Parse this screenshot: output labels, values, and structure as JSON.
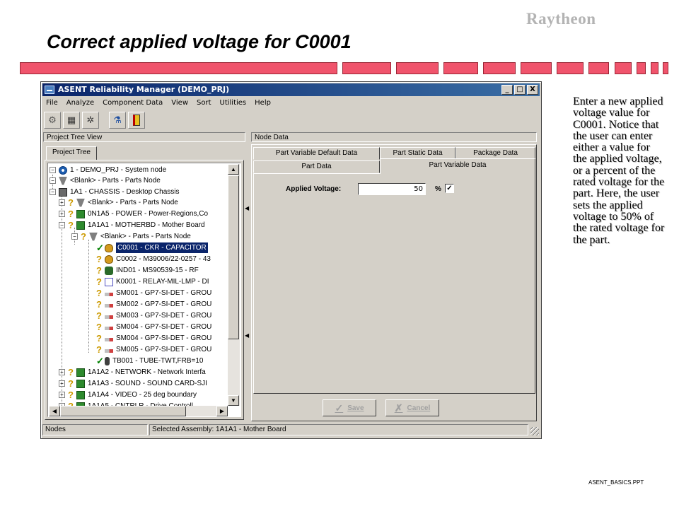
{
  "slide": {
    "logo_text": "Raytheon",
    "title": "Correct applied voltage for C0001",
    "description": "Enter a new applied voltage value for C0001. Notice that the user can enter either a value for the applied voltage, or a percent of the rated voltage for the part. Here, the user sets the applied voltage to 50% of the rated voltage for the part.",
    "footer": "ASENT_BASICS.PPT",
    "stripe_color": "#f0546c"
  },
  "window": {
    "title": "ASENT Reliability Manager (DEMO_PRJ)",
    "caption_buttons": [
      "_",
      "□",
      "X"
    ],
    "menu": [
      "File",
      "Analyze",
      "Component Data",
      "View",
      "Sort",
      "Utilities",
      "Help"
    ],
    "toolbar_icons": [
      "parts-library-icon",
      "calculator-icon",
      "settings-gear-icon",
      "analysis-icon",
      "exit-door-icon"
    ],
    "title_color": "#0a246a"
  },
  "project_tree": {
    "pane_label": "Project Tree View",
    "tab_label": "Project Tree",
    "rows": [
      {
        "text": "1  -  DEMO_PRJ  -  System node",
        "icon": "system-node-icon"
      },
      {
        "text": "<Blank>  -  Parts  -  Parts Node",
        "icon": "parts-node-icon"
      },
      {
        "text": "1A1  -  CHASSIS  -  Desktop Chassis",
        "icon": "chassis-icon"
      },
      {
        "text": "<Blank>  -  Parts  -  Parts Node",
        "icon": "parts-node-icon"
      },
      {
        "text": "0N1A5  -  POWER  -  Power-Regions,Co",
        "icon": "board-icon"
      },
      {
        "text": "1A1A1  -  MOTHERBD  -  Mother Board",
        "icon": "board-icon"
      },
      {
        "text": "<Blank>  -  Parts  -  Parts Node",
        "icon": "parts-node-icon"
      },
      {
        "text": "C0001  -  CKR  -  CAPACITOR",
        "icon": "capacitor-icon",
        "status": "check"
      },
      {
        "text": "C0002  -  M39006/22-0257  -  43",
        "icon": "capacitor-icon",
        "status": "question"
      },
      {
        "text": "IND01  -  MS90539-15  -  RF",
        "icon": "inductor-icon",
        "status": "question"
      },
      {
        "text": "K0001  -  RELAY-MIL-LMP  -  DI",
        "icon": "relay-icon",
        "status": "question"
      },
      {
        "text": "SM001  -  GP7-SI-DET  -  GROU",
        "icon": "semiconductor-icon",
        "status": "question"
      },
      {
        "text": "SM002  -  GP7-SI-DET  -  GROU",
        "icon": "semiconductor-icon",
        "status": "question"
      },
      {
        "text": "SM003  -  GP7-SI-DET  -  GROU",
        "icon": "semiconductor-icon",
        "status": "question"
      },
      {
        "text": "SM004  -  GP7-SI-DET  -  GROU",
        "icon": "semiconductor-icon",
        "status": "question"
      },
      {
        "text": "SM004  -  GP7-SI-DET  -  GROU",
        "icon": "semiconductor-icon",
        "status": "question"
      },
      {
        "text": "SM005  -  GP7-SI-DET  -  GROU",
        "icon": "semiconductor-icon",
        "status": "question"
      },
      {
        "text": "TB001  -  TUBE-TWT,FRB=10",
        "icon": "tube-icon",
        "status": "check"
      },
      {
        "text": "1A1A2  -  NETWORK  -  Network Interfa",
        "icon": "board-icon",
        "status": "question"
      },
      {
        "text": "1A1A3  -  SOUND  -  SOUND CARD-SJI",
        "icon": "board-icon",
        "status": "question"
      },
      {
        "text": "1A1A4  -  VIDEO  -  25 deg boundary",
        "icon": "board-icon",
        "status": "question"
      },
      {
        "text": "1A1A5  -  CNTRLR  -  Drive Controll",
        "icon": "board-icon",
        "status": "question"
      }
    ]
  },
  "node_data": {
    "pane_label": "Node Data",
    "tabs_back": [
      "Part Variable Default Data",
      "Part Static Data",
      "Package Data"
    ],
    "tabs_front": [
      "Part Data",
      "Part Variable Data"
    ],
    "active_tab": "Part Variable Data",
    "applied_voltage_label": "Applied Voltage:",
    "applied_voltage_value": "50",
    "percent_symbol": "%",
    "percent_checked": "✓",
    "save_label": "Save",
    "cancel_label": "Cancel"
  },
  "statusbar": {
    "left": "Nodes",
    "right": "Selected Assembly: 1A1A1  -  Mother Board"
  }
}
